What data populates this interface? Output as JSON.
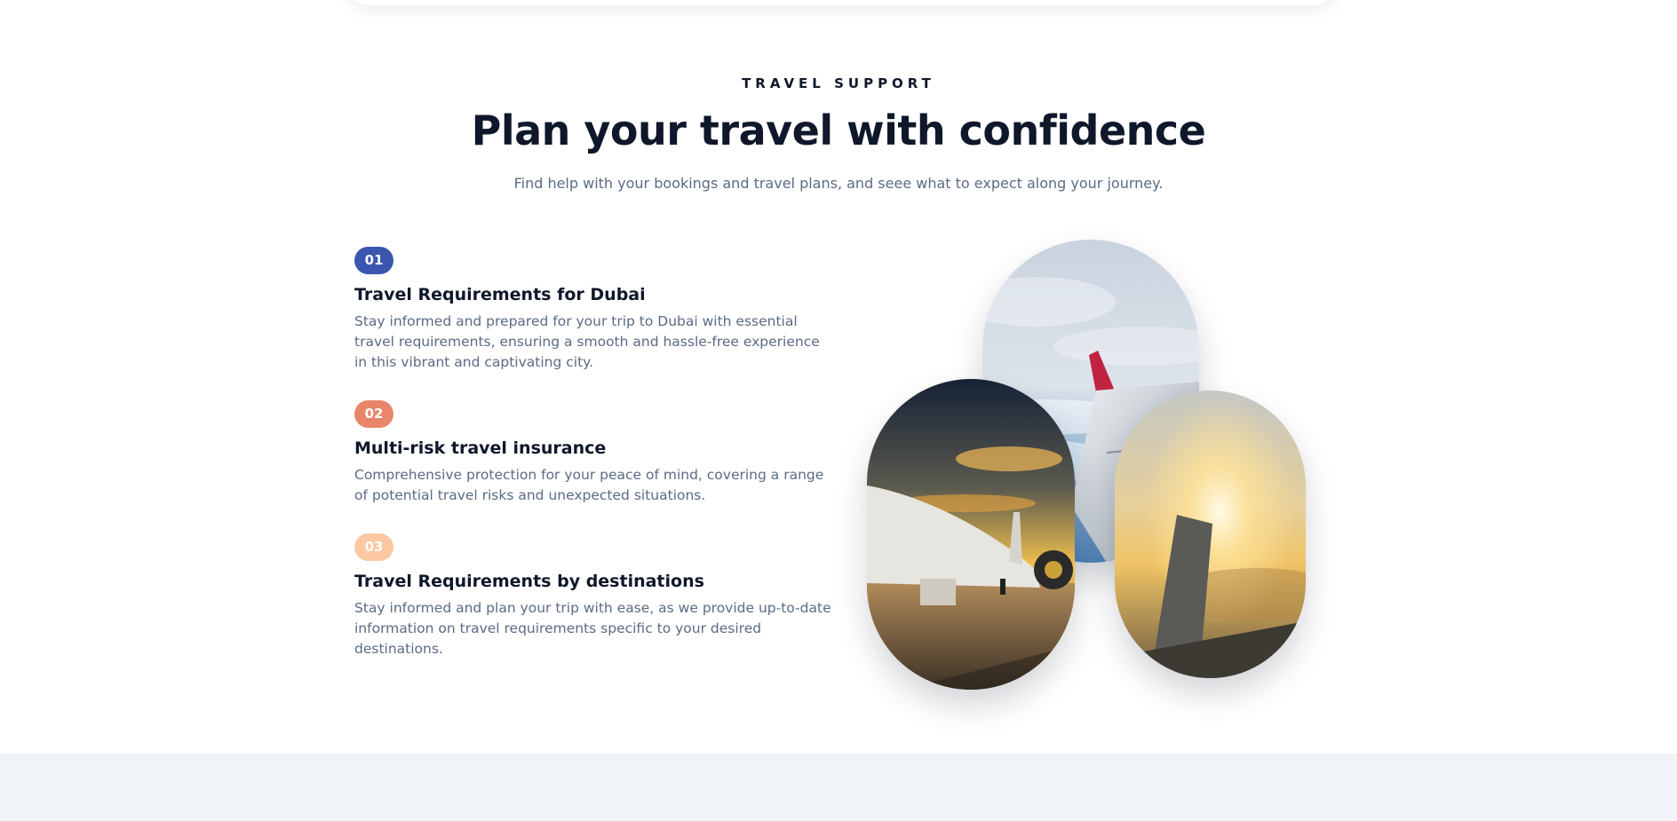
{
  "section": {
    "eyebrow": "TRAVEL SUPPORT",
    "title": "Plan your travel with confidence",
    "subtitle": "Find help with your bookings and travel plans, and seee what to expect along your journey."
  },
  "features": [
    {
      "number": "01",
      "badge_color": "#3a56b0",
      "title": "Travel Requirements for Dubai",
      "description": "Stay informed and prepared for your trip to Dubai with essential travel requirements, ensuring a smooth and hassle-free experience in this vibrant and captivating city."
    },
    {
      "number": "02",
      "badge_color": "#e8866a",
      "title": "Multi-risk travel insurance",
      "description": "Comprehensive protection for your peace of mind, covering a range of potential travel risks and unexpected situations."
    },
    {
      "number": "03",
      "badge_color": "#fcc8a2",
      "title": "Travel Requirements by destinations",
      "description": "Stay informed and plan your trip with ease, as we provide up-to-date information on travel requirements specific to your desired destinations."
    }
  ],
  "colors": {
    "heading": "#0f172a",
    "body_text": "#5b6b84",
    "bottom_band": "#f0f3f7"
  },
  "images": [
    "airplane-wing-clouds-photo",
    "sunset-wing-photo",
    "airplane-tarmac-sunset-photo"
  ]
}
